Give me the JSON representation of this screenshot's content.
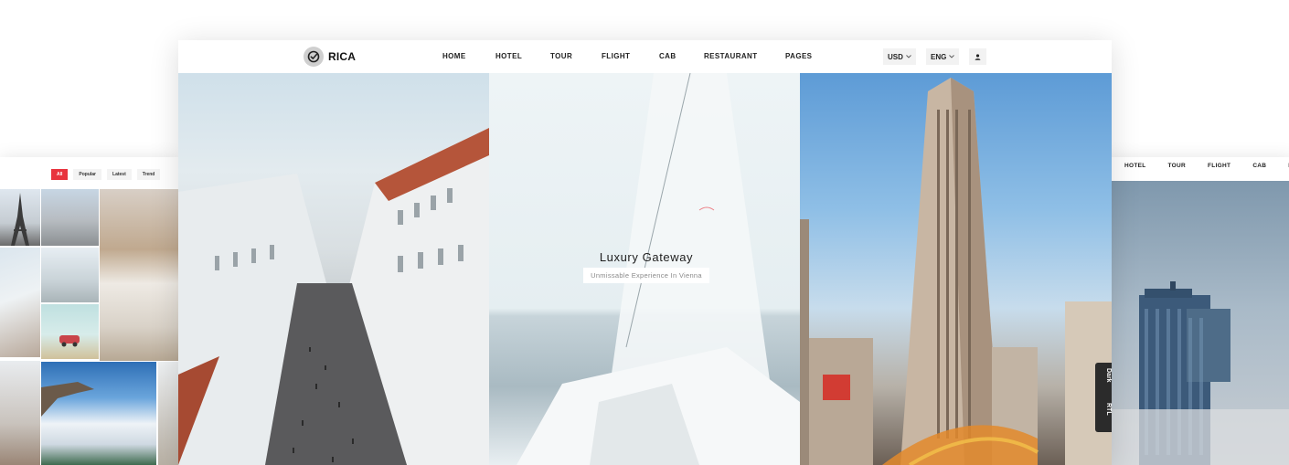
{
  "left_preview": {
    "filters": [
      "All",
      "Popular",
      "Latest",
      "Trend"
    ],
    "active_filter": "All"
  },
  "right_preview": {
    "nav": [
      "HOTEL",
      "TOUR",
      "FLIGHT",
      "CAB",
      "RE"
    ]
  },
  "header": {
    "brand": "RICA",
    "nav": [
      "HOME",
      "HOTEL",
      "TOUR",
      "FLIGHT",
      "CAB",
      "RESTAURANT",
      "PAGES"
    ],
    "currency": "USD",
    "language": "ENG"
  },
  "hero_center": {
    "title": "Luxury Gateway",
    "subtitle": "Unmissable Experience In Vienna"
  },
  "side_toggles": {
    "dark": "Dark",
    "rtl": "RTL"
  },
  "colors": {
    "accent_red": "#e8333d",
    "text_dark": "#222222",
    "toggle_bg": "#2b2b2b"
  },
  "icons": [
    "check-circle-logo-icon",
    "chevron-down-icon",
    "user-icon"
  ]
}
